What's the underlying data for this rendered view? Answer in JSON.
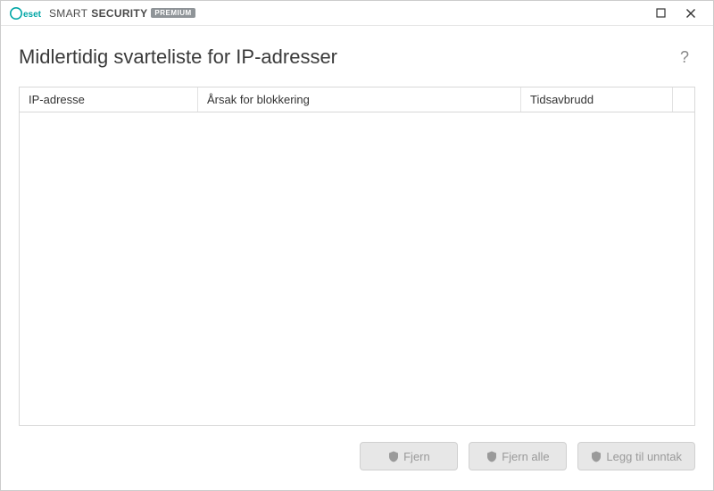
{
  "titlebar": {
    "brand_smart": "SMART",
    "brand_security": "SECURITY",
    "brand_badge": "PREMIUM"
  },
  "header": {
    "title": "Midlertidig svarteliste for IP-adresser",
    "help_label": "?"
  },
  "table": {
    "columns": {
      "ip": "IP-adresse",
      "reason": "Årsak for blokkering",
      "timeout": "Tidsavbrudd"
    },
    "rows": []
  },
  "footer": {
    "remove": "Fjern",
    "remove_all": "Fjern alle",
    "add_exception": "Legg til unntak"
  }
}
